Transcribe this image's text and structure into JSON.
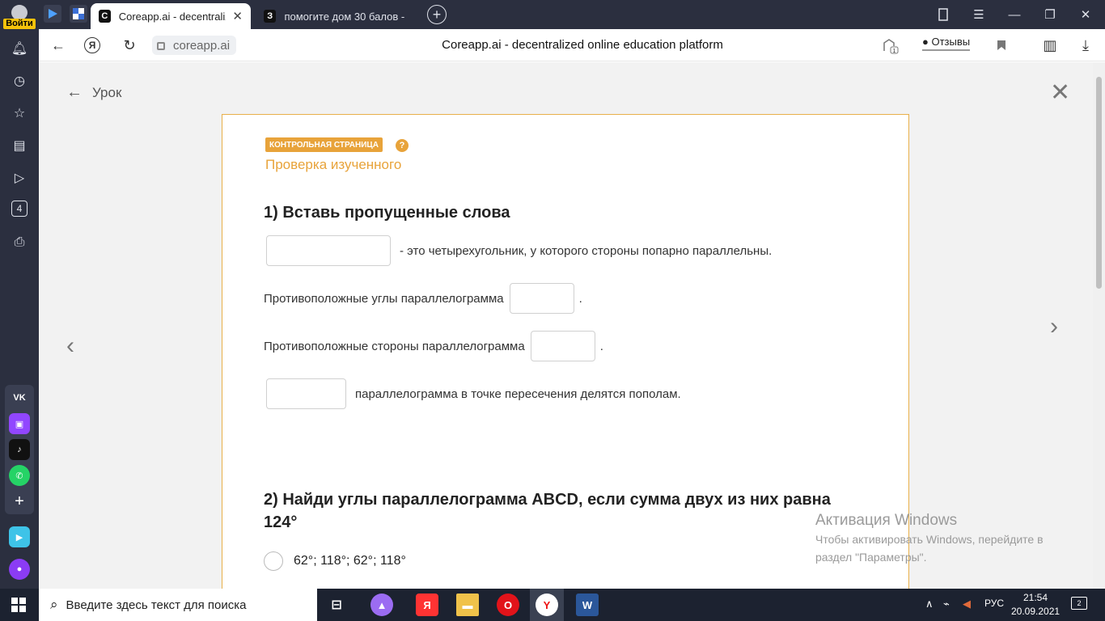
{
  "browser": {
    "login_label": "Войти",
    "tabs": [
      {
        "title": "Coreapp.ai - decentraliz",
        "favicon": "C",
        "active": true
      },
      {
        "title": "помогите дом 30 балов -",
        "favicon": "З",
        "active": false
      }
    ],
    "new_tab": "+",
    "domain": "coreapp.ai",
    "page_title": "Coreapp.ai - decentralized online education platform",
    "reviews_label": "Отзывы",
    "notif_badge": "1",
    "sidebar_badge": "4"
  },
  "lesson": {
    "back_label": "Урок",
    "badge": "КОНТРОЛЬНАЯ СТРАНИЦА",
    "help": "?",
    "subtitle": "Проверка изученного",
    "q1": {
      "title": "1) Вставь пропущенные слова",
      "line1_text": "- это четырехугольник, у которого стороны попарно параллельны.",
      "line2_text": "Противоположные углы параллелограмма",
      "line2_end": ".",
      "line3_text": "Противоположные стороны параллелограмма",
      "line3_end": ".",
      "line4_text": "параллелограмма в точке пересечения делятся пополам."
    },
    "q2": {
      "title_line1": "2) Найди углы параллелограмма ABCD, если сумма двух из них равна",
      "title_line2": "124°",
      "option1": "62°; 118°; 62°; 118°"
    }
  },
  "watermark": {
    "heading": "Активация Windows",
    "line1": "Чтобы активировать Windows, перейдите в",
    "line2": "раздел \"Параметры\"."
  },
  "taskbar": {
    "search_placeholder": "Введите здесь текст для поиска",
    "lang": "РУС",
    "time": "21:54",
    "date": "20.09.2021",
    "notif_count": "2"
  },
  "colors": {
    "accent": "#e8a33a",
    "chrome": "#2b2f3f",
    "taskbar": "#1c2230"
  }
}
